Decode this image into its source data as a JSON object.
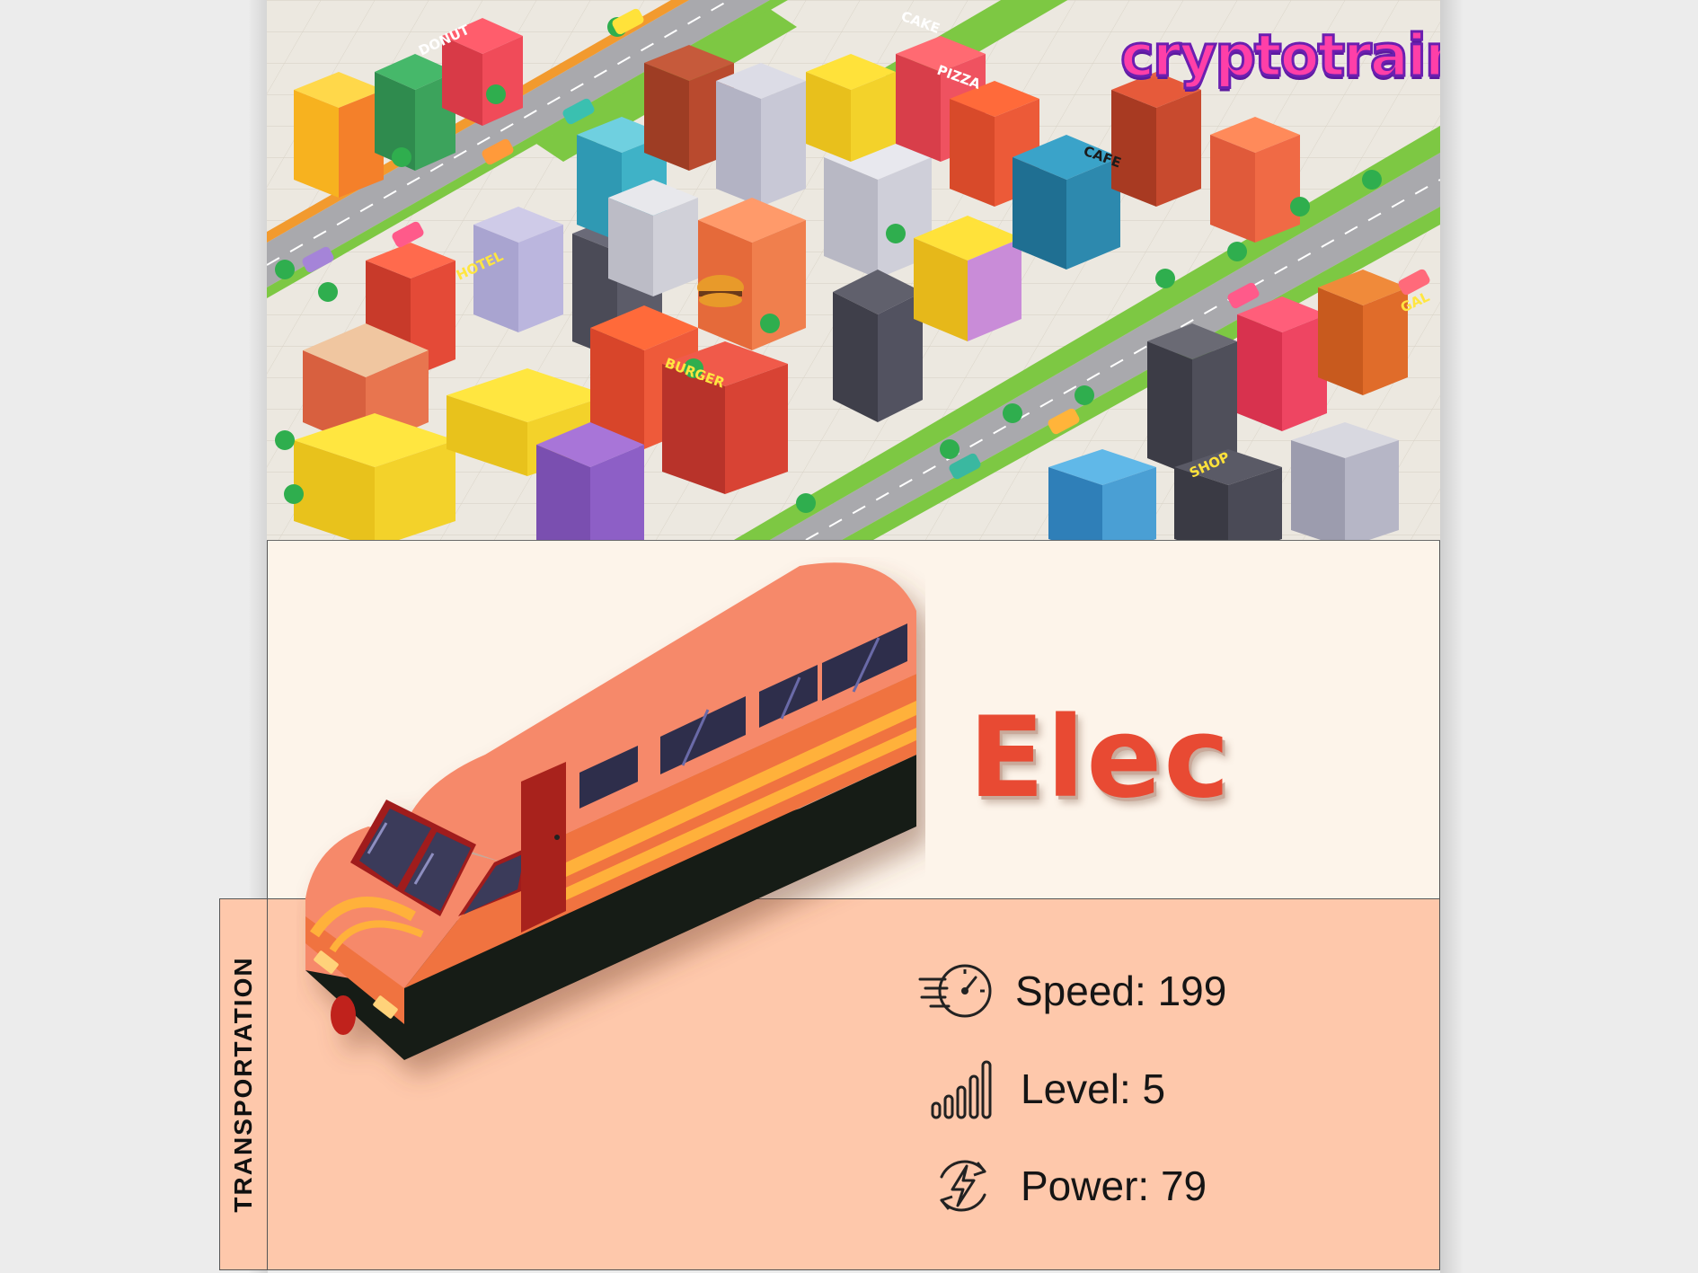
{
  "branding": {
    "logo_text": "cryptotrains"
  },
  "train": {
    "name": "Elec",
    "category": "TRANSPORTATION"
  },
  "stats": {
    "speed": {
      "label": "Speed",
      "value": "199",
      "icon": "speedometer-icon"
    },
    "level": {
      "label": "Level",
      "value": "5",
      "icon": "signal-bars-icon"
    },
    "power": {
      "label": "Power",
      "value": "79",
      "icon": "lightning-cycle-icon"
    }
  },
  "city_signs": [
    "DONUT",
    "HOTEL",
    "BURGER",
    "CAFE",
    "PIZZA",
    "CAKE",
    "SHOP",
    "GAL"
  ],
  "colors": {
    "hero_background": "#fdf4ea",
    "stats_background": "#fec8ab",
    "name_color": "#e84a33",
    "train_body": "#f0733f"
  }
}
